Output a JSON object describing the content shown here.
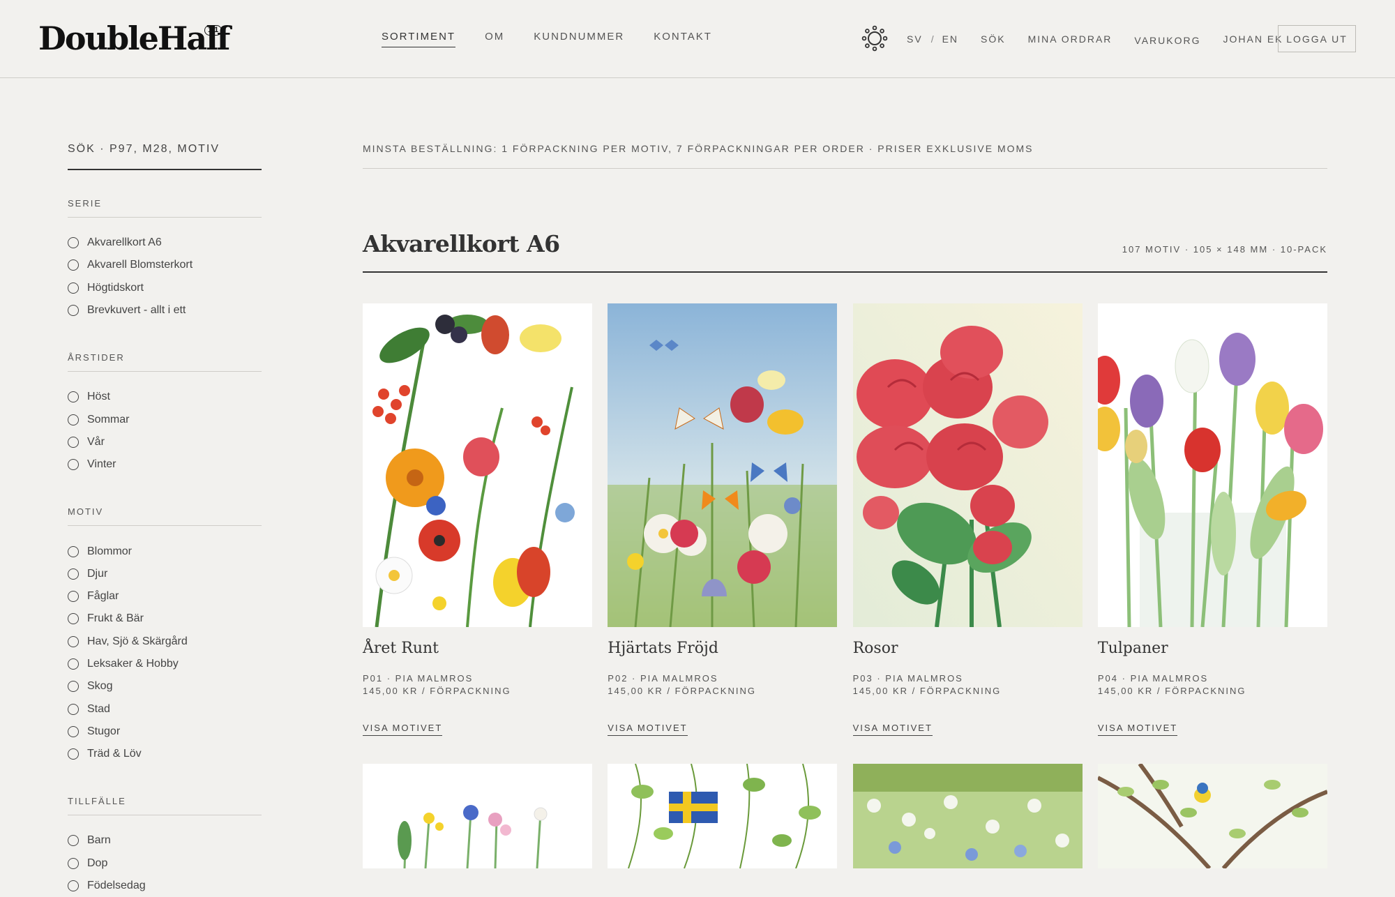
{
  "header": {
    "logo": "DoubleHalf",
    "logo_badge": "1/1",
    "nav": [
      "SORTIMENT",
      "OM",
      "KUNDNUMMER",
      "KONTAKT"
    ],
    "lang_sv": "SV",
    "lang_sep": "/",
    "lang_en": "EN",
    "search": "SÖK",
    "orders": "MINA ORDRAR",
    "cart": "VARUKORG",
    "user": "JOHAN EK",
    "logout": "LOGGA UT"
  },
  "sidebar": {
    "search_placeholder": "SÖK · P97, M28, MOTIV",
    "groups": [
      {
        "title": "SERIE",
        "options": [
          "Akvarellkort A6",
          "Akvarell Blomsterkort",
          "Högtidskort",
          "Brevkuvert - allt i ett"
        ]
      },
      {
        "title": "ÅRSTIDER",
        "options": [
          "Höst",
          "Sommar",
          "Vår",
          "Vinter"
        ]
      },
      {
        "title": "MOTIV",
        "options": [
          "Blommor",
          "Djur",
          "Fåglar",
          "Frukt & Bär",
          "Hav, Sjö & Skärgård",
          "Leksaker & Hobby",
          "Skog",
          "Stad",
          "Stugor",
          "Träd & Löv"
        ]
      },
      {
        "title": "TILLFÄLLE",
        "options": [
          "Barn",
          "Dop",
          "Födelsedag"
        ]
      }
    ]
  },
  "main": {
    "notice": "MINSTA BESTÄLLNING: 1 FÖRPACKNING PER MOTIV, 7 FÖRPACKNINGAR PER ORDER · PRISER EXKLUSIVE MOMS",
    "section_title": "Akvarellkort A6",
    "section_meta": "107 MOTIV · 105 × 148 MM · 10-PACK",
    "cards": [
      {
        "title": "Året Runt",
        "code": "P01 · PIA MALMROS",
        "price": "145,00 KR / FÖRPACKNING",
        "link": "VISA MOTIVET"
      },
      {
        "title": "Hjärtats Fröjd",
        "code": "P02 · PIA MALMROS",
        "price": "145,00 KR / FÖRPACKNING",
        "link": "VISA MOTIVET"
      },
      {
        "title": "Rosor",
        "code": "P03 · PIA MALMROS",
        "price": "145,00 KR / FÖRPACKNING",
        "link": "VISA MOTIVET"
      },
      {
        "title": "Tulpaner",
        "code": "P04 · PIA MALMROS",
        "price": "145,00 KR / FÖRPACKNING",
        "link": "VISA MOTIVET"
      }
    ]
  },
  "colors": {
    "background": "#f2f1ee",
    "text": "#3a3a3a",
    "rule": "#cfcdc8"
  }
}
